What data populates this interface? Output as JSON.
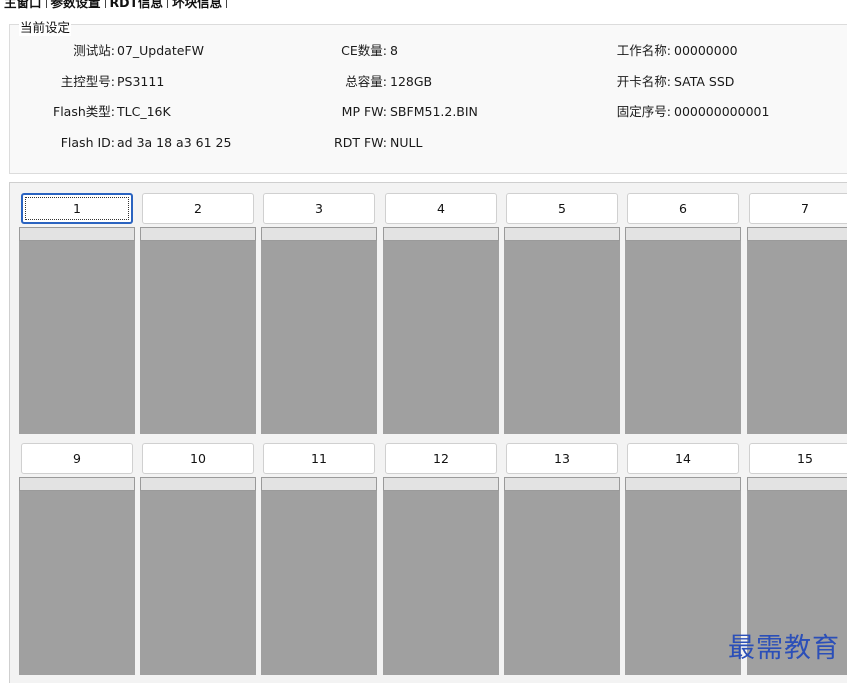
{
  "tabs": [
    {
      "label": "主窗口"
    },
    {
      "label": "参数设置"
    },
    {
      "label": "RDT信息"
    },
    {
      "label": "坏块信息"
    }
  ],
  "settings": {
    "title": "当前设定",
    "fields": [
      {
        "key": "test_station",
        "label": "测试站:",
        "value": "07_UpdateFW"
      },
      {
        "key": "controller",
        "label": "主控型号:",
        "value": "PS3111"
      },
      {
        "key": "flash_type",
        "label": "Flash类型:",
        "value": "TLC_16K"
      },
      {
        "key": "flash_id",
        "label": "Flash ID:",
        "value": "ad 3a 18 a3 61 25"
      },
      {
        "key": "ce_count",
        "label": "CE数量:",
        "value": "8"
      },
      {
        "key": "capacity",
        "label": "总容量:",
        "value": "128GB"
      },
      {
        "key": "mp_fw",
        "label": "MP FW:",
        "value": "SBFM51.2.BIN"
      },
      {
        "key": "rdt_fw",
        "label": "RDT FW:",
        "value": "NULL"
      },
      {
        "key": "job_name",
        "label": "工作名称:",
        "value": "00000000"
      },
      {
        "key": "card_name",
        "label": "开卡名称:",
        "value": "SATA SSD"
      },
      {
        "key": "fixed_serial",
        "label": "固定序号:",
        "value": "000000000001"
      }
    ]
  },
  "slots": {
    "row1": [
      "1",
      "2",
      "3",
      "4",
      "5",
      "6",
      "7"
    ],
    "row2": [
      "9",
      "10",
      "11",
      "12",
      "13",
      "14",
      "15"
    ],
    "panel_color": "#a0a0a0",
    "focused_slot": "1"
  },
  "watermark": "最需教育"
}
